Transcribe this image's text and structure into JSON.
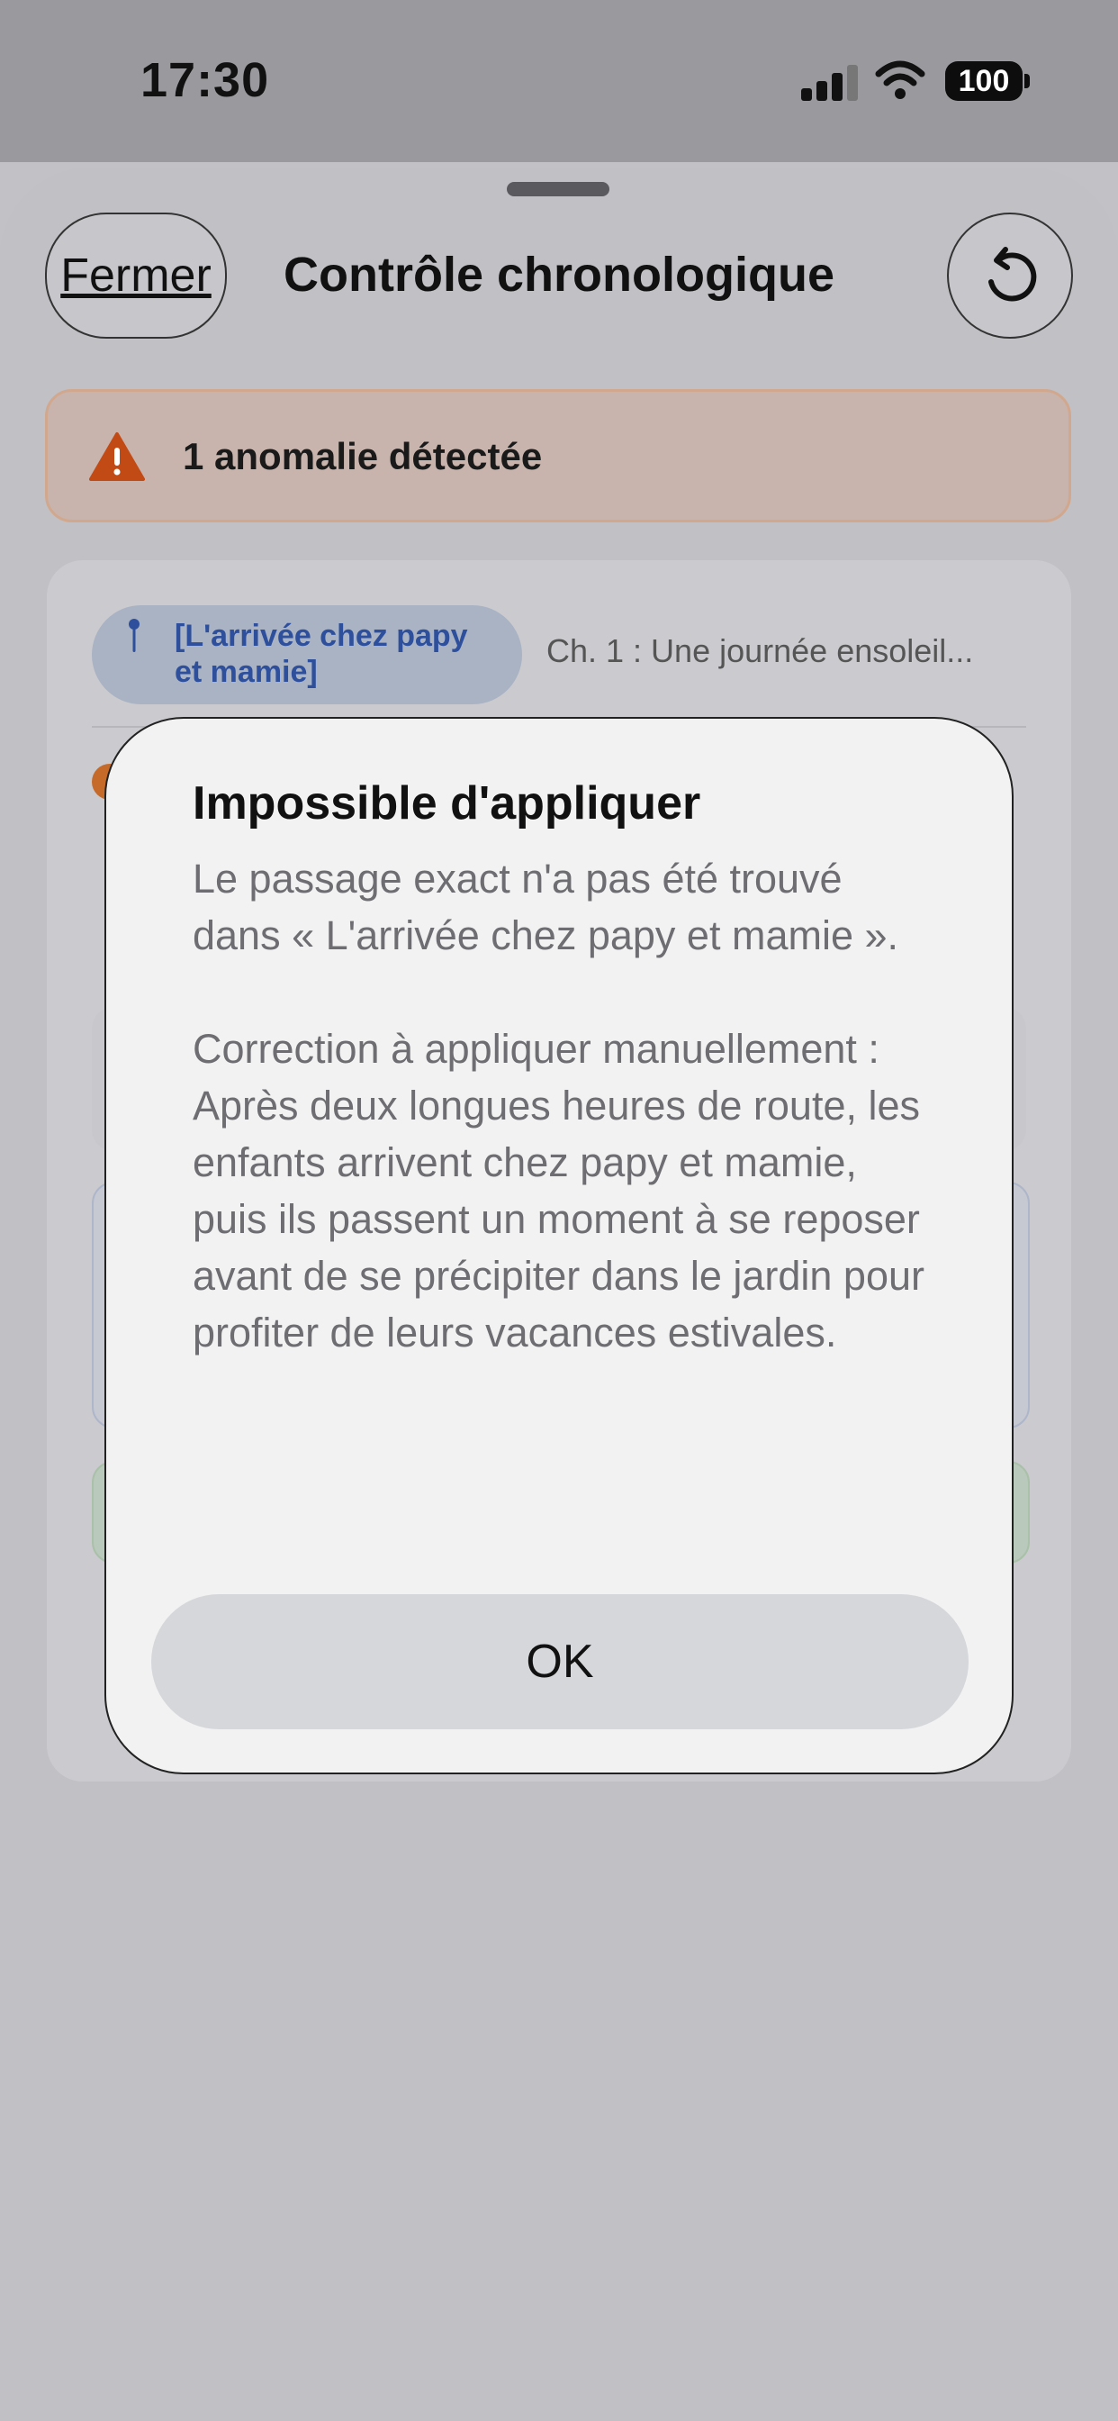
{
  "status_bar": {
    "time": "17:30",
    "battery": "100",
    "icons": [
      "signal-icon",
      "wifi-icon",
      "battery-icon"
    ]
  },
  "sheet": {
    "close_label": "Fermer",
    "title": "Contrôle chronologique",
    "undo_icon": "undo-icon"
  },
  "alert": {
    "icon": "warning-triangle-icon",
    "text": "1 anomalie détectée",
    "color": "#c24a14"
  },
  "card": {
    "chip_label": "[L'arrivée chez papy et mamie]",
    "chip_icon": "pin-icon",
    "chapter": "Ch. 1 : Une journée ensoleil..."
  },
  "dialog": {
    "title": "Impossible d'appliquer",
    "message_line1": "Le passage exact n'a pas été trouvé dans « L'arrivée chez papy et mamie ».",
    "message_line2": "Correction à appliquer manuellement :",
    "message_line3": "Après deux longues heures de route, les enfants arrivent chez papy et mamie, puis ils passent un moment à se reposer avant de se précipiter dans le jardin pour profiter de leurs vacances estivales.",
    "ok_label": "OK"
  }
}
